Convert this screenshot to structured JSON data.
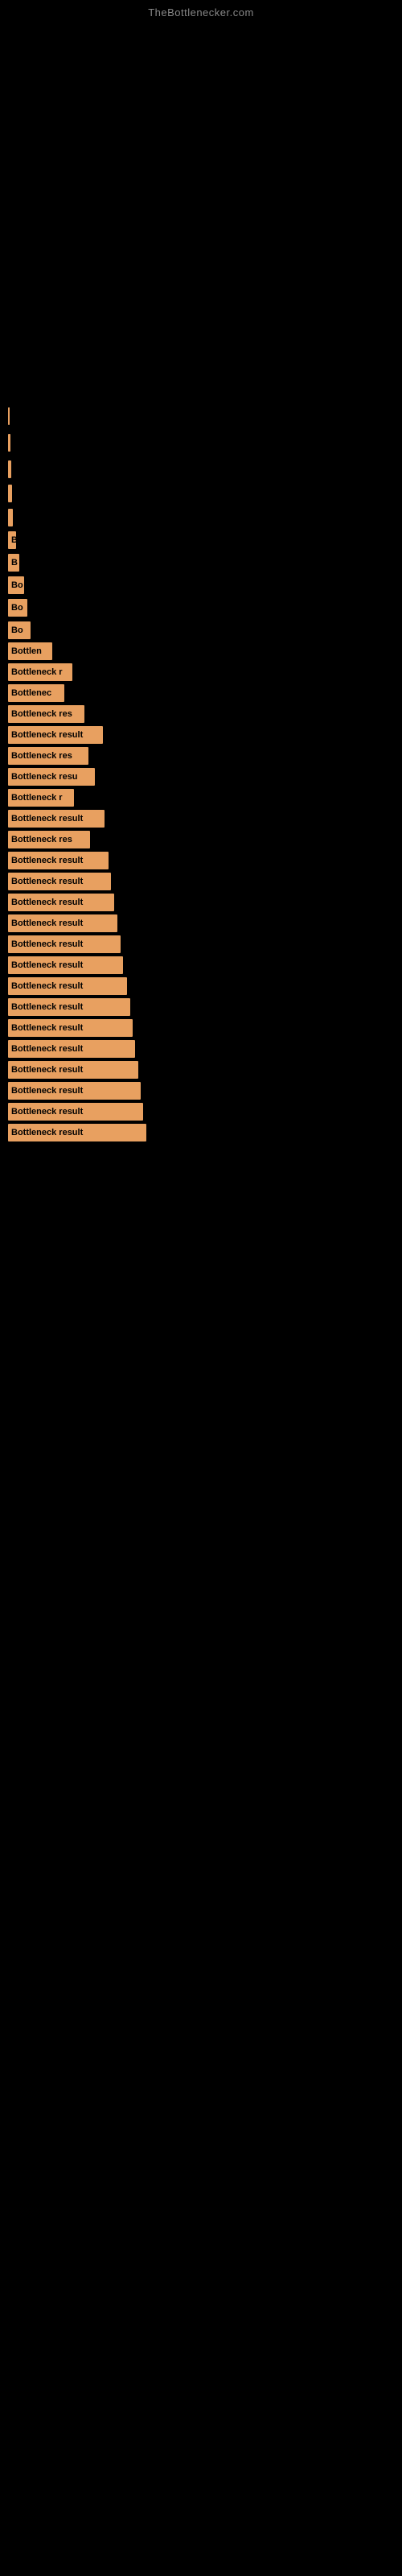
{
  "site": {
    "title": "TheBottlenecker.com"
  },
  "bars": [
    {
      "label": "",
      "width": 0,
      "top_gap": 30
    },
    {
      "label": "",
      "width": 0,
      "top_gap": 20
    },
    {
      "label": "",
      "width": 2,
      "top_gap": 15
    },
    {
      "label": "",
      "width": 3,
      "top_gap": 15
    },
    {
      "label": "",
      "width": 4,
      "top_gap": 15
    },
    {
      "label": "",
      "width": 5,
      "top_gap": 12
    },
    {
      "label": "",
      "width": 6,
      "top_gap": 12
    },
    {
      "label": "B",
      "width": 10,
      "top_gap": 10
    },
    {
      "label": "B",
      "width": 14,
      "top_gap": 10
    },
    {
      "label": "Bo",
      "width": 20,
      "top_gap": 10
    },
    {
      "label": "Bo",
      "width": 24,
      "top_gap": 10
    },
    {
      "label": "Bo",
      "width": 28,
      "top_gap": 10
    },
    {
      "label": "Bottlen",
      "width": 55,
      "top_gap": 8
    },
    {
      "label": "Bottleneck r",
      "width": 80,
      "top_gap": 8
    },
    {
      "label": "Bottlenec",
      "width": 70,
      "top_gap": 8
    },
    {
      "label": "Bottleneck res",
      "width": 95,
      "top_gap": 8
    },
    {
      "label": "Bottleneck result",
      "width": 118,
      "top_gap": 8
    },
    {
      "label": "Bottleneck res",
      "width": 100,
      "top_gap": 8
    },
    {
      "label": "Bottleneck resu",
      "width": 108,
      "top_gap": 8
    },
    {
      "label": "Bottleneck r",
      "width": 82,
      "top_gap": 8
    },
    {
      "label": "Bottleneck result",
      "width": 120,
      "top_gap": 8
    },
    {
      "label": "Bottleneck res",
      "width": 102,
      "top_gap": 8
    },
    {
      "label": "Bottleneck result",
      "width": 125,
      "top_gap": 8
    },
    {
      "label": "Bottleneck result",
      "width": 128,
      "top_gap": 8
    },
    {
      "label": "Bottleneck result",
      "width": 132,
      "top_gap": 8
    },
    {
      "label": "Bottleneck result",
      "width": 136,
      "top_gap": 8
    },
    {
      "label": "Bottleneck result",
      "width": 140,
      "top_gap": 8
    },
    {
      "label": "Bottleneck result",
      "width": 143,
      "top_gap": 8
    },
    {
      "label": "Bottleneck result",
      "width": 148,
      "top_gap": 8
    },
    {
      "label": "Bottleneck result",
      "width": 152,
      "top_gap": 8
    },
    {
      "label": "Bottleneck result",
      "width": 155,
      "top_gap": 8
    },
    {
      "label": "Bottleneck result",
      "width": 158,
      "top_gap": 8
    },
    {
      "label": "Bottleneck result",
      "width": 162,
      "top_gap": 8
    },
    {
      "label": "Bottleneck result",
      "width": 165,
      "top_gap": 8
    },
    {
      "label": "Bottleneck result",
      "width": 168,
      "top_gap": 8
    },
    {
      "label": "Bottleneck result",
      "width": 172,
      "top_gap": 8
    }
  ]
}
